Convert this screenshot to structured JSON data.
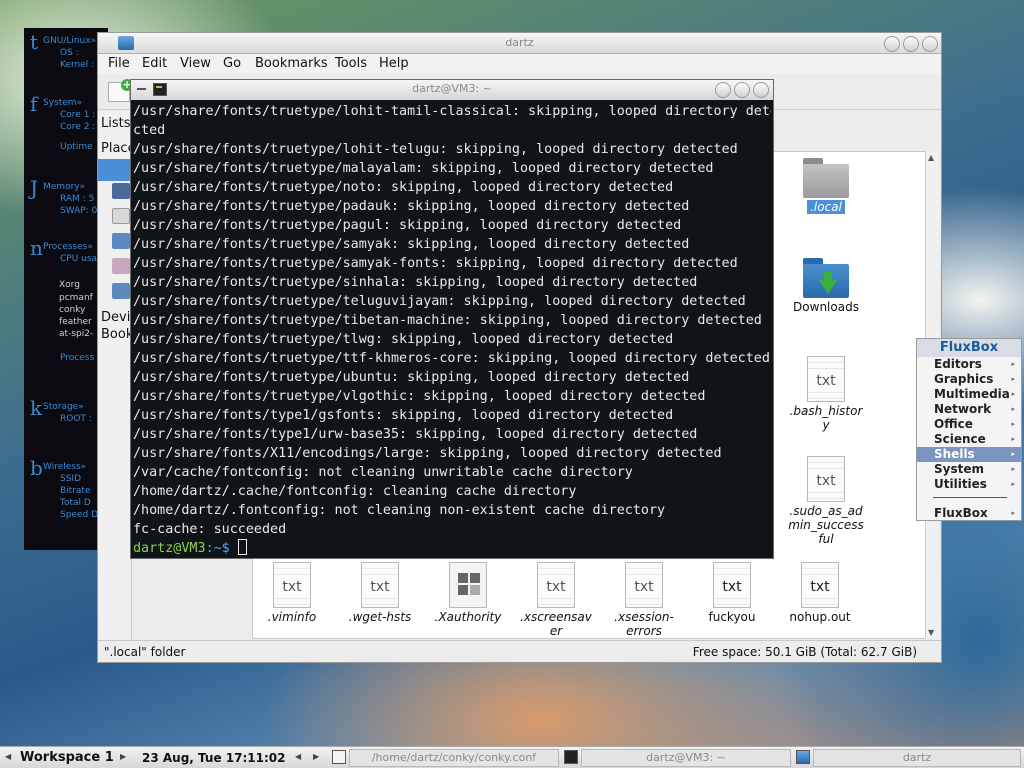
{
  "conky": {
    "sections": [
      {
        "glyph": "t",
        "head": "GNU/Linux»",
        "lines": [
          "OS    :",
          "Kernel :"
        ]
      },
      {
        "glyph": "f",
        "head": "System»",
        "lines": [
          "Core 1 :",
          "Core 2 :",
          "Uptime"
        ]
      },
      {
        "glyph": "J",
        "head": "Memory»",
        "lines": [
          "RAM : 5",
          "SWAP: 0"
        ]
      },
      {
        "glyph": "n",
        "head": "Processes»",
        "lines": [
          "CPU usa",
          "Xorg",
          "pcmanf",
          "conky",
          "feather",
          "at-spi2-",
          "Process"
        ]
      },
      {
        "glyph": "k",
        "head": "Storage»",
        "lines": [
          "ROOT : "
        ]
      },
      {
        "glyph": "b",
        "head": "Wireless»",
        "lines": [
          "SSID",
          "Bitrate",
          "Total D",
          "Speed D"
        ]
      }
    ]
  },
  "file_manager": {
    "title": "dartz",
    "menu": [
      "File",
      "Edit",
      "View",
      "Go",
      "Bookmarks",
      "Tools",
      "Help"
    ],
    "side_tab": "Lists",
    "side_places": "Place",
    "side_devices": "Devic",
    "side_bookmarks": "Book",
    "files": {
      "local": ".local",
      "downloads": "Downloads",
      "bash_history": ".bash_histor\ny",
      "sudo": ".sudo_as_ad\nmin_success\nful",
      "viminfo": ".viminfo",
      "wget": ".wget-hsts",
      "xauthority": ".Xauthority",
      "xscreensaver": ".xscreensav\ner",
      "xsession": ".xsession-\nerrors",
      "fuckyou": "fuckyou",
      "nohup": "nohup.out",
      "txt_glyph": "txt"
    },
    "status_left": "\".local\" folder",
    "status_right": "Free space: 50.1 GiB (Total: 62.7 GiB)"
  },
  "terminal": {
    "title": "dartz@VM3: ~",
    "lines": [
      "/usr/share/fonts/truetype/lohit-tamil-classical: skipping, looped directory dete",
      "cted",
      "/usr/share/fonts/truetype/lohit-telugu: skipping, looped directory detected",
      "/usr/share/fonts/truetype/malayalam: skipping, looped directory detected",
      "/usr/share/fonts/truetype/noto: skipping, looped directory detected",
      "/usr/share/fonts/truetype/padauk: skipping, looped directory detected",
      "/usr/share/fonts/truetype/pagul: skipping, looped directory detected",
      "/usr/share/fonts/truetype/samyak: skipping, looped directory detected",
      "/usr/share/fonts/truetype/samyak-fonts: skipping, looped directory detected",
      "/usr/share/fonts/truetype/sinhala: skipping, looped directory detected",
      "/usr/share/fonts/truetype/teluguvijayam: skipping, looped directory detected",
      "/usr/share/fonts/truetype/tibetan-machine: skipping, looped directory detected",
      "/usr/share/fonts/truetype/tlwg: skipping, looped directory detected",
      "/usr/share/fonts/truetype/ttf-khmeros-core: skipping, looped directory detected",
      "/usr/share/fonts/truetype/ubuntu: skipping, looped directory detected",
      "/usr/share/fonts/truetype/vlgothic: skipping, looped directory detected",
      "/usr/share/fonts/type1/gsfonts: skipping, looped directory detected",
      "/usr/share/fonts/type1/urw-base35: skipping, looped directory detected",
      "/usr/share/fonts/X11/encodings/large: skipping, looped directory detected",
      "/var/cache/fontconfig: not cleaning unwritable cache directory",
      "/home/dartz/.cache/fontconfig: cleaning cache directory",
      "/home/dartz/.fontconfig: not cleaning non-existent cache directory",
      "fc-cache: succeeded"
    ],
    "prompt_user": "dartz@VM3",
    "prompt_path": ":~$ "
  },
  "fluxbox_menu": {
    "title": "FluxBox",
    "items": [
      "Editors",
      "Graphics",
      "Multimedia",
      "Network",
      "Office",
      "Science",
      "Shells",
      "System",
      "Utilities"
    ],
    "active": "Shells",
    "footer": "FluxBox"
  },
  "taskbar": {
    "workspace": "Workspace 1",
    "clock": "23 Aug, Tue 17:11:02",
    "tasks": [
      "/home/dartz/conky/conky.conf",
      "dartz@VM3: ~",
      "dartz"
    ]
  },
  "colors": {
    "selection": "#4a90d9",
    "fluxbox_active": "#7a95bf",
    "prompt_user": "#8fd14f",
    "prompt_path": "#4aa3ff",
    "conky_text": "#3a8ad0"
  }
}
